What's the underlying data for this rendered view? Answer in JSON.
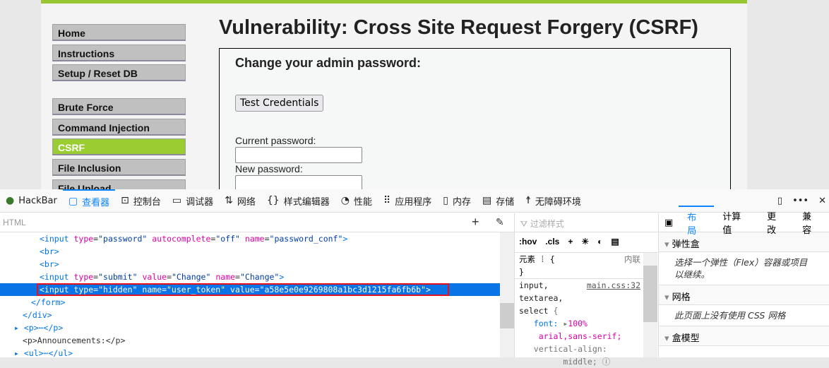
{
  "page": {
    "title": "Vulnerability: Cross Site Request Forgery (CSRF)",
    "nav": [
      "Home",
      "Instructions",
      "Setup / Reset DB",
      "Brute Force",
      "Command Injection",
      "CSRF",
      "File Inclusion",
      "File Upload"
    ],
    "active_nav": "CSRF",
    "form": {
      "heading": "Change your admin password:",
      "test_button": "Test Credentials",
      "current_label": "Current password:",
      "new_label": "New password:"
    },
    "accent": "#9acd32"
  },
  "devtools": {
    "tabs": [
      {
        "icon": "hackbar-icon",
        "label": "HackBar"
      },
      {
        "icon": "inspector-icon",
        "label": "查看器"
      },
      {
        "icon": "console-icon",
        "label": "控制台"
      },
      {
        "icon": "debugger-icon",
        "label": "调试器"
      },
      {
        "icon": "network-icon",
        "label": "网络"
      },
      {
        "icon": "style-editor-icon",
        "label": "样式编辑器"
      },
      {
        "icon": "performance-icon",
        "label": "性能"
      },
      {
        "icon": "application-icon",
        "label": "应用程序"
      },
      {
        "icon": "memory-icon",
        "label": "内存"
      },
      {
        "icon": "storage-icon",
        "label": "存储"
      },
      {
        "icon": "accessibility-icon",
        "label": "无障碍环境"
      }
    ],
    "selected_tab": "查看器",
    "markup_label": "HTML",
    "markup": {
      "l0": {
        "tag": "<input ",
        "attrs": [
          {
            "n": "type",
            "v": "\"password\""
          },
          {
            "n": "autocomplete",
            "v": "\"off\""
          },
          {
            "n": "name",
            "v": "\"password_conf\""
          }
        ],
        "end": ">"
      },
      "l1": "<br>",
      "l2": "<br>",
      "l3": {
        "tag": "<input ",
        "attrs": [
          {
            "n": "type",
            "v": "\"submit\""
          },
          {
            "n": "value",
            "v": "\"Change\""
          },
          {
            "n": "name",
            "v": "\"Change\""
          }
        ],
        "end": ">"
      },
      "l4": "<input type=\"hidden\" name=\"user_token\" value=\"a58e5e0e9269808a1bc3d1215fa6fb6b\">",
      "l5": "</form>",
      "l6": "</div>",
      "l7": "<p>⋯</p>",
      "l8": "<p>Announcements:</p>",
      "l9": "<ul>⋯</ul>"
    },
    "rules": {
      "filter_placeholder": "过滤样式",
      "hov": ":hov",
      "cls": ".cls",
      "element": "元素",
      "inline": "内联",
      "selector": "input,\ntextarea,\nselect",
      "source": "main.css:32",
      "prop1": "font:",
      "val1": "100%",
      "val1b": "arial,sans-serif;",
      "prop2": "vertical-align:",
      "val2": "middle;"
    },
    "layout": {
      "tabs": [
        "布局",
        "计算值",
        "更改",
        "兼容"
      ],
      "flex": "弹性盒",
      "flex_note": "选择一个弹性（Flex）容器或项目以继续。",
      "grid": "网格",
      "grid_note": "此页面上没有使用 CSS 网格",
      "box": "盒模型"
    }
  }
}
